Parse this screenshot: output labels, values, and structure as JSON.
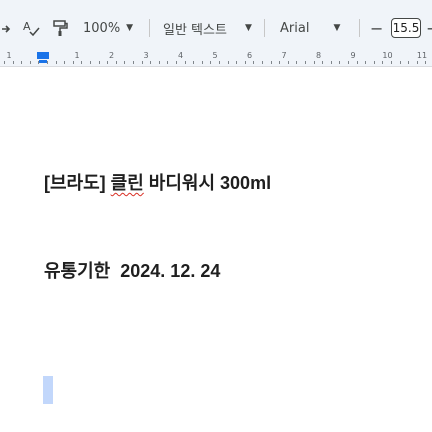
{
  "toolbar": {
    "spellcheck_icon": "spellcheck-icon",
    "paint_format_icon": "paint-format-icon",
    "zoom": "100%",
    "style": "일반 텍스트",
    "font": "Arial",
    "font_size": "15.5",
    "decrease": "−",
    "increase": "+"
  },
  "ruler": {
    "numbers": [
      "1",
      "1",
      "2",
      "3",
      "4",
      "5",
      "6",
      "7",
      "8",
      "9",
      "10",
      "11"
    ]
  },
  "document": {
    "line1_prefix": "[브라도] ",
    "line1_misspelled": "클린",
    "line1_suffix": " 바디워시 300ml",
    "line2_label": "유통기한",
    "line2_date": "2024. 12. 24"
  },
  "colors": {
    "toolbar_bg": "#f0f4f9",
    "accent": "#1a73e8",
    "spell_error": "#d93025",
    "selection": "#c2d7fb"
  }
}
